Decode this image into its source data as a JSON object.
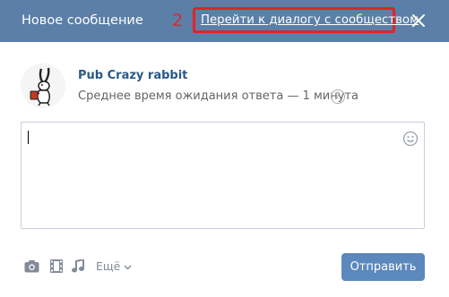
{
  "header": {
    "title": "Новое сообщение",
    "annotation_number": "2",
    "goto_dialog_link": "Перейти к диалогу с сообществом"
  },
  "recipient": {
    "name": "Pub Crazy rabbit",
    "subtitle": "Среднее время ожидания ответа — 1 минута",
    "help_glyph": "?"
  },
  "message": {
    "value": ""
  },
  "toolbar": {
    "icons": [
      "camera-icon",
      "film-icon",
      "music-note-icon"
    ],
    "more_label": "Ещё",
    "send_label": "Отправить"
  },
  "colors": {
    "header_bg": "#5b7fa6",
    "annotation_red": "#e32227",
    "link_blue": "#2a5885",
    "button_blue": "#5b88bd",
    "icon_gray": "#828a99"
  }
}
